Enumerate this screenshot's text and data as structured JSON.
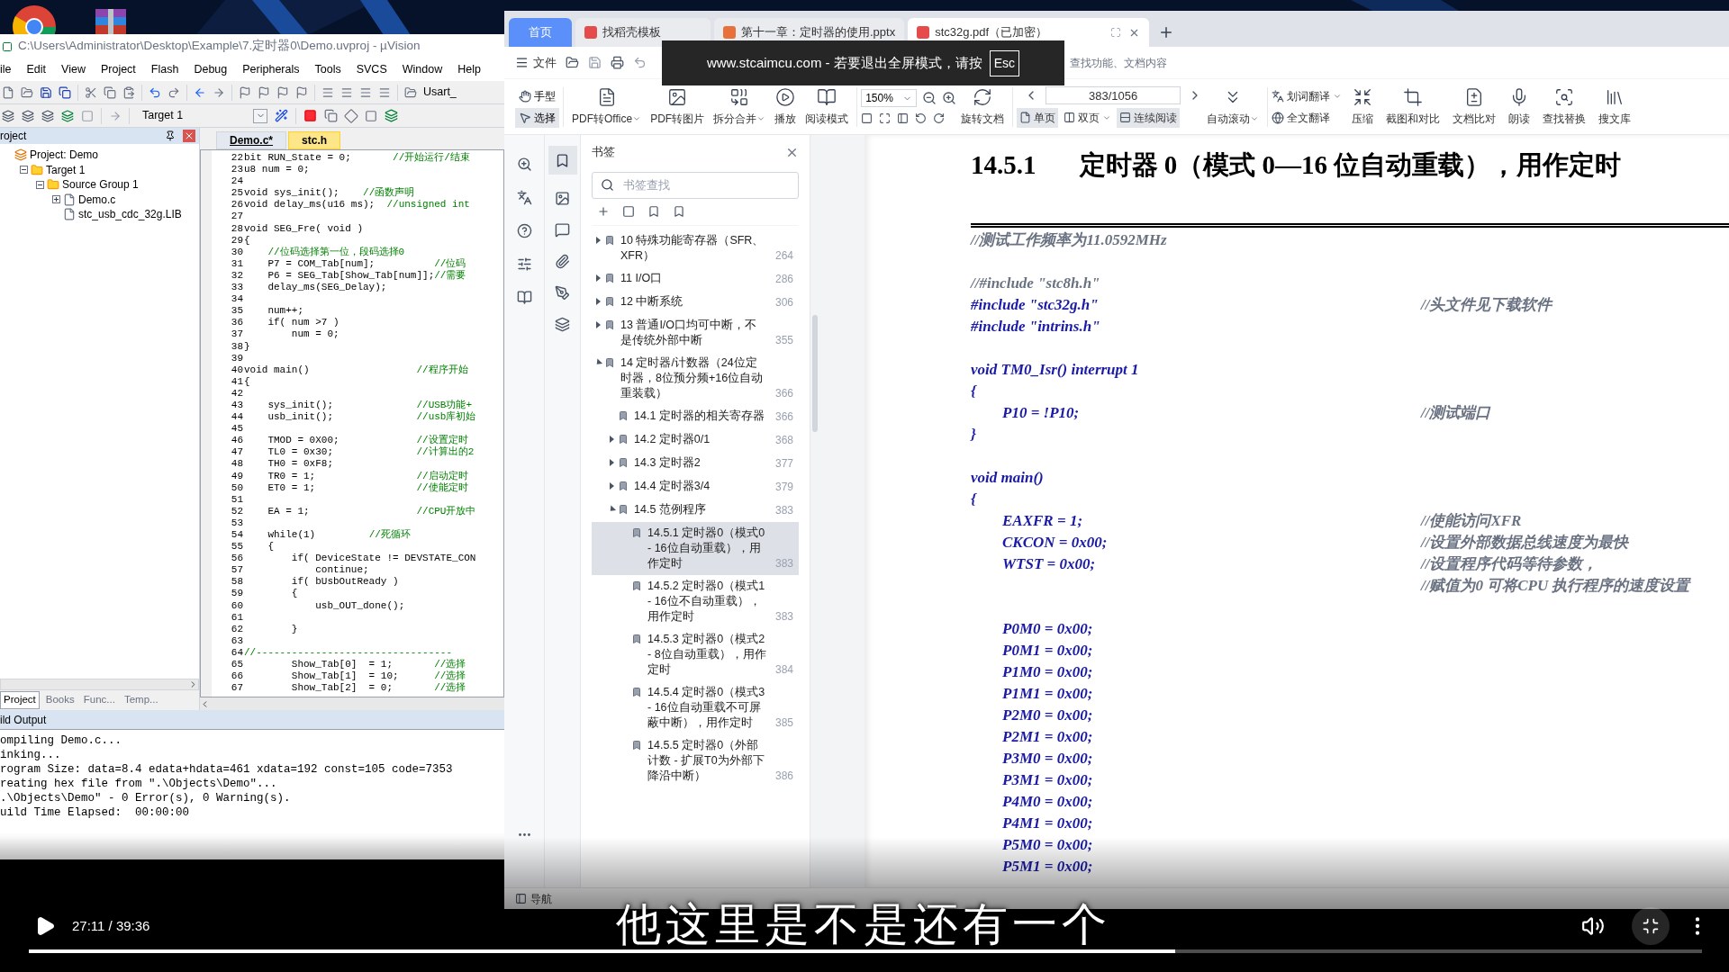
{
  "keil": {
    "title": "C:\\Users\\Administrator\\Desktop\\Example\\7.定时器0\\Demo.uvproj - µVision",
    "menu": [
      "ile",
      "Edit",
      "View",
      "Project",
      "Flash",
      "Debug",
      "Peripherals",
      "Tools",
      "SVCS",
      "Window",
      "Help"
    ],
    "toolbar_text": "Usart_",
    "target": "Target 1",
    "project_panel": {
      "title": "roject",
      "tree": [
        {
          "label": "Project: Demo",
          "kind": "project",
          "children": [
            {
              "label": "Target 1",
              "kind": "folder",
              "expanded": true,
              "children": [
                {
                  "label": "Source Group 1",
                  "kind": "folder",
                  "expanded": true,
                  "children": [
                    {
                      "label": "Demo.c",
                      "kind": "file",
                      "expanded": false
                    },
                    {
                      "label": "stc_usb_cdc_32g.LIB",
                      "kind": "file"
                    }
                  ]
                }
              ]
            }
          ]
        }
      ],
      "tabs": [
        {
          "label": "Project",
          "selected": true
        },
        {
          "label": "Books",
          "selected": false
        },
        {
          "label": "Func...",
          "selected": false
        },
        {
          "label": "Temp...",
          "selected": false
        }
      ]
    },
    "editor": {
      "tabs": [
        {
          "label": "Demo.c*",
          "selected": true
        },
        {
          "label": "stc.h",
          "selected": false
        }
      ],
      "lines": [
        {
          "n": "22",
          "code": "bit RUN_State = 0;       ",
          "comment": "//开始运行/结束"
        },
        {
          "n": "23",
          "code": "u8 num = 0;"
        },
        {
          "n": "24"
        },
        {
          "n": "25",
          "code": "void sys_init();    ",
          "comment": "//函数声明"
        },
        {
          "n": "26",
          "code": "void delay_ms(u16 ms);  ",
          "comment": "//unsigned int"
        },
        {
          "n": "27"
        },
        {
          "n": "28",
          "code": "void SEG_Fre( void )"
        },
        {
          "n": "29",
          "code": "{"
        },
        {
          "n": "30",
          "comment": "    //位码选择第一位，段码选择0"
        },
        {
          "n": "31",
          "code": "    P7 = COM_Tab[num];          ",
          "comment": "//位码"
        },
        {
          "n": "32",
          "code": "    P6 = SEG_Tab[Show_Tab[num]];",
          "comment": "//需要"
        },
        {
          "n": "33",
          "code": "    delay_ms(SEG_Delay);"
        },
        {
          "n": "34"
        },
        {
          "n": "35",
          "code": "    num++;"
        },
        {
          "n": "36",
          "code": "    if( num >7 )"
        },
        {
          "n": "37",
          "code": "        num = 0;"
        },
        {
          "n": "38",
          "code": "}"
        },
        {
          "n": "39"
        },
        {
          "n": "40",
          "code": "void main()                  ",
          "comment": "//程序开始"
        },
        {
          "n": "41",
          "code": "{"
        },
        {
          "n": "42"
        },
        {
          "n": "43",
          "code": "    sys_init();              ",
          "comment": "//USB功能+"
        },
        {
          "n": "44",
          "code": "    usb_init();              ",
          "comment": "//usb库初始"
        },
        {
          "n": "45"
        },
        {
          "n": "46",
          "code": "    TMOD = 0X00;             ",
          "comment": "//设置定时"
        },
        {
          "n": "47",
          "code": "    TL0 = 0x30;              ",
          "comment": "//计算出的2"
        },
        {
          "n": "48",
          "code": "    TH0 = 0xF8;"
        },
        {
          "n": "49",
          "code": "    TR0 = 1;                 ",
          "comment": "//启动定时"
        },
        {
          "n": "50",
          "code": "    ET0 = 1;                 ",
          "comment": "//使能定时"
        },
        {
          "n": "51"
        },
        {
          "n": "52",
          "code": "    EA = 1;                  ",
          "comment": "//CPU开放中"
        },
        {
          "n": "53"
        },
        {
          "n": "54",
          "code": "    while(1)         ",
          "comment": "//死循环"
        },
        {
          "n": "55",
          "code": "    {"
        },
        {
          "n": "56",
          "code": "        if( DeviceState != DEVSTATE_CON"
        },
        {
          "n": "57",
          "code": "            continue;"
        },
        {
          "n": "58",
          "code": "        if( bUsbOutReady )"
        },
        {
          "n": "59",
          "code": "        {"
        },
        {
          "n": "60",
          "code": "            usb_OUT_done();"
        },
        {
          "n": "61"
        },
        {
          "n": "62",
          "code": "        }"
        },
        {
          "n": "63"
        },
        {
          "n": "64",
          "comment": "//---------------------------------"
        },
        {
          "n": "65",
          "code": "        Show_Tab[0]  = 1;       ",
          "comment": "//选择"
        },
        {
          "n": "66",
          "code": "        Show_Tab[1]  = 10;      ",
          "comment": "//选择"
        },
        {
          "n": "67",
          "code": "        Show_Tab[2]  = 0;       ",
          "comment": "//选择"
        }
      ]
    },
    "build_output": {
      "title": "ild Output",
      "lines": [
        "ompiling Demo.c...",
        "inking...",
        "rogram Size: data=8.4 edata+hdata=461 xdata=192 const=105 code=7353",
        "reating hex file from \".\\Objects\\Demo\"...",
        ".\\Objects\\Demo\" - 0 Error(s), 0 Warning(s).",
        "uild Time Elapsed:  00:00:00"
      ]
    }
  },
  "pdf": {
    "tabs": [
      {
        "label": "首页",
        "kind": "home",
        "selected": false
      },
      {
        "label": "找稻壳模板",
        "kind": "template",
        "selected": false
      },
      {
        "label": "第十一章：定时器的使用.pptx",
        "kind": "slides",
        "selected": false
      },
      {
        "label": "stc32g.pdf（已加密）",
        "kind": "pdf",
        "selected": true
      }
    ],
    "menu": {
      "file": "文件",
      "search_hint": "查找功能、文档内容"
    },
    "toolbar": {
      "modes": [
        {
          "label": "手型",
          "selected": false
        },
        {
          "label": "选择",
          "selected": true
        }
      ],
      "tools": [
        {
          "label": "PDF转Office",
          "dropdown": true
        },
        {
          "label": "PDF转图片",
          "dropdown": false
        },
        {
          "label": "拆分合并",
          "dropdown": true
        },
        {
          "label": "播放",
          "dropdown": false
        },
        {
          "label": "阅读模式",
          "dropdown": false
        }
      ],
      "zoom": "150%",
      "rotate": "旋转文档",
      "page": "383/1056",
      "views": [
        {
          "label": "单页",
          "selected": true,
          "dropdown": false
        },
        {
          "label": "双页",
          "selected": false,
          "dropdown": true
        },
        {
          "label": "连续阅读",
          "selected": true,
          "dropdown": false
        }
      ],
      "autoscroll": {
        "label": "自动滚动",
        "dropdown": true
      },
      "translate": [
        {
          "label": "划词翻译",
          "dropdown": true
        },
        {
          "label": "全文翻译",
          "dropdown": false
        }
      ],
      "extras": [
        "压缩",
        "截图和对比",
        "文档比对",
        "朗读",
        "查找替换",
        "搜文库"
      ]
    },
    "bookmarks": {
      "title": "书签",
      "placeholder": "书签查找",
      "items": [
        {
          "label": "10 特殊功能寄存器（SFR、XFR）",
          "page": "264",
          "selected": false,
          "expanded": false
        },
        {
          "label": "11 I/O口",
          "page": "286",
          "selected": false,
          "expanded": false
        },
        {
          "label": "12 中断系统",
          "page": "306",
          "selected": false,
          "expanded": false
        },
        {
          "label": "13 普通I/O口均可中断，不是传统外部中断",
          "page": "355",
          "selected": false,
          "expanded": false
        },
        {
          "label": "14 定时器/计数器（24位定时器，8位预分频+16位自动重装载）",
          "page": "366",
          "selected": false,
          "expanded": true,
          "children": [
            {
              "label": "14.1 定时器的相关寄存器",
              "page": "366",
              "selected": false
            },
            {
              "label": "14.2 定时器0/1",
              "page": "368",
              "selected": false,
              "expanded": false
            },
            {
              "label": "14.3 定时器2",
              "page": "377",
              "selected": false,
              "expanded": false
            },
            {
              "label": "14.4 定时器3/4",
              "page": "379",
              "selected": false,
              "expanded": false
            },
            {
              "label": "14.5 范例程序",
              "page": "383",
              "selected": false,
              "expanded": true,
              "children": [
                {
                  "label": "14.5.1 定时器0（模式0 - 16位自动重载），用作定时",
                  "page": "383",
                  "selected": true
                },
                {
                  "label": "14.5.2 定时器0（模式1 - 16位不自动重载），用作定时",
                  "page": "383",
                  "selected": false
                },
                {
                  "label": "14.5.3 定时器0（模式2 - 8位自动重载），用作定时",
                  "page": "384",
                  "selected": false
                },
                {
                  "label": "14.5.4 定时器0（模式3 - 16位自动重载不可屏蔽中断），用作定时",
                  "page": "385",
                  "selected": false
                },
                {
                  "label": "14.5.5 定时器0（外部计数 - 扩展T0为外部下降沿中断）",
                  "page": "386",
                  "selected": false
                }
              ]
            }
          ]
        }
      ]
    },
    "page": {
      "number": "14.5.1",
      "heading": "定时器 0（模式 0—16 位自动重载），用作定时",
      "blocks": [
        [
          {
            "kind": "note",
            "code": "//测试工作频率为11.0592MHz",
            "indented": false
          }
        ],
        [
          {
            "kind": "note",
            "code": "//#include \"stc8h.h\"",
            "indented": false
          },
          {
            "kind": "code",
            "code": "#include \"stc32g.h\"",
            "comment": "//头文件见下载软件",
            "indented": false
          },
          {
            "kind": "code",
            "code": "#include \"intrins.h\"",
            "indented": false
          }
        ],
        [
          {
            "kind": "code",
            "code": "void TM0_Isr() interrupt 1",
            "indented": false
          },
          {
            "kind": "code",
            "code": "{",
            "indented": false
          },
          {
            "kind": "code",
            "code": "P10 = !P10;",
            "comment": "//测试端口",
            "indented": true
          },
          {
            "kind": "code",
            "code": "}",
            "indented": false
          }
        ],
        [
          {
            "kind": "code",
            "code": "void main()",
            "indented": false
          },
          {
            "kind": "code",
            "code": "{",
            "indented": false
          },
          {
            "kind": "code",
            "code": "EAXFR = 1;",
            "comment": "//使能访问XFR",
            "indented": true
          },
          {
            "kind": "code",
            "code": "CKCON = 0x00;",
            "comment": "//设置外部数据总线速度为最快",
            "indented": true
          },
          {
            "kind": "code",
            "code": "WTST = 0x00;",
            "comment": "//设置程序代码等待参数，",
            "indented": true
          },
          {
            "kind": "code",
            "comment": "//赋值为0 可将CPU 执行程序的速度设置"
          }
        ],
        [
          {
            "kind": "code",
            "code": "P0M0 = 0x00;",
            "indented": true
          },
          {
            "kind": "code",
            "code": "P0M1 = 0x00;",
            "indented": true
          },
          {
            "kind": "code",
            "code": "P1M0 = 0x00;",
            "indented": true
          },
          {
            "kind": "code",
            "code": "P1M1 = 0x00;",
            "indented": true
          },
          {
            "kind": "code",
            "code": "P2M0 = 0x00;",
            "indented": true
          },
          {
            "kind": "code",
            "code": "P2M1 = 0x00;",
            "indented": true
          },
          {
            "kind": "code",
            "code": "P3M0 = 0x00;",
            "indented": true
          },
          {
            "kind": "code",
            "code": "P3M1 = 0x00;",
            "indented": true
          },
          {
            "kind": "code",
            "code": "P4M0 = 0x00;",
            "indented": true
          },
          {
            "kind": "code",
            "code": "P4M1 = 0x00;",
            "indented": true
          },
          {
            "kind": "code",
            "code": "P5M0 = 0x00;",
            "indented": true
          },
          {
            "kind": "code",
            "code": "P5M1 = 0x00;",
            "indented": true
          }
        ]
      ]
    },
    "status": {
      "nav": "导航"
    }
  },
  "fullscreen_notice": {
    "text": "www.stcaimcu.com - 若要退出全屏模式，请按",
    "key": "Esc"
  },
  "player": {
    "subtitle": "他这里是不是还有一个",
    "time": "27:11 / 39:36",
    "level": 0.685
  }
}
